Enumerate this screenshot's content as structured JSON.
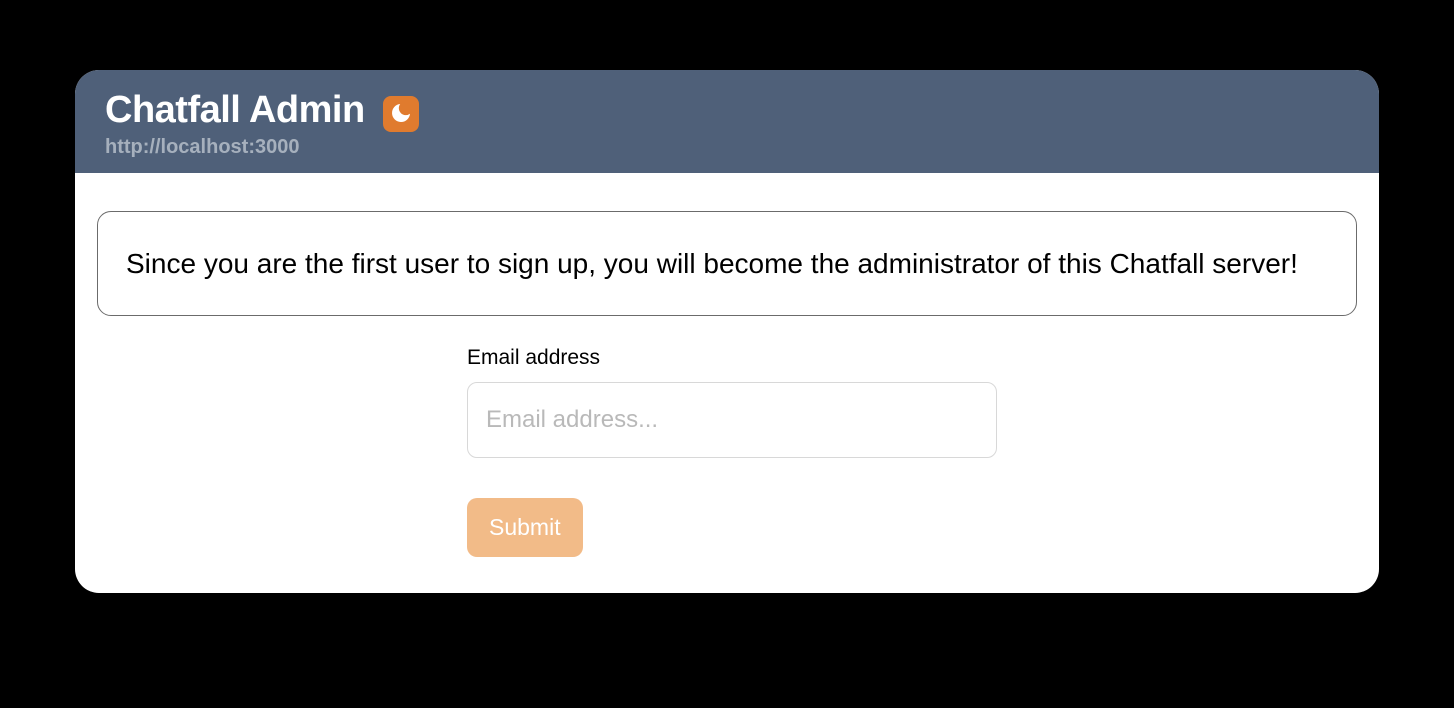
{
  "header": {
    "title": "Chatfall Admin",
    "server_url": "http://localhost:3000"
  },
  "info": {
    "message": "Since you are the first user to sign up, you will become the administrator of this Chatfall server!"
  },
  "form": {
    "email_label": "Email address",
    "email_placeholder": "Email address...",
    "email_value": "",
    "submit_label": "Submit"
  },
  "colors": {
    "header_bg": "#4f6079",
    "accent": "#e07b2e",
    "submit_bg": "#f2bb88"
  }
}
